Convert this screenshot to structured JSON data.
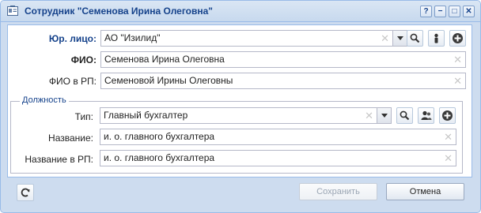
{
  "window": {
    "title": "Сотрудник \"Семенова Ирина Олеговна\"",
    "controls": [
      "?",
      "−",
      "□",
      "✕"
    ]
  },
  "form": {
    "legal_entity": {
      "label": "Юр. лицо:",
      "value": "АО \"Изилид\""
    },
    "fio": {
      "label": "ФИО:",
      "value": "Семенова Ирина Олеговна"
    },
    "fio_rp": {
      "label": "ФИО в РП:",
      "value": "Семеновой Ирины Олеговны"
    }
  },
  "position": {
    "legend": "Должность",
    "type": {
      "label": "Тип:",
      "value": "Главный бухгалтер"
    },
    "name": {
      "label": "Название:",
      "value": "и. о. главного бухгалтера"
    },
    "name_rp": {
      "label": "Название в РП:",
      "value": "и. о. главного бухгалтера"
    }
  },
  "footer": {
    "save_label": "Сохранить",
    "cancel_label": "Отмена"
  },
  "colors": {
    "accent": "#15428b",
    "border": "#99bbe8",
    "frame": "#cddcef"
  },
  "icons": {
    "title": "employee-card-icon",
    "clear": "clear-icon",
    "search": "search-icon",
    "person": "person-icon",
    "people": "people-icon",
    "add": "add-icon",
    "refresh": "refresh-icon"
  }
}
